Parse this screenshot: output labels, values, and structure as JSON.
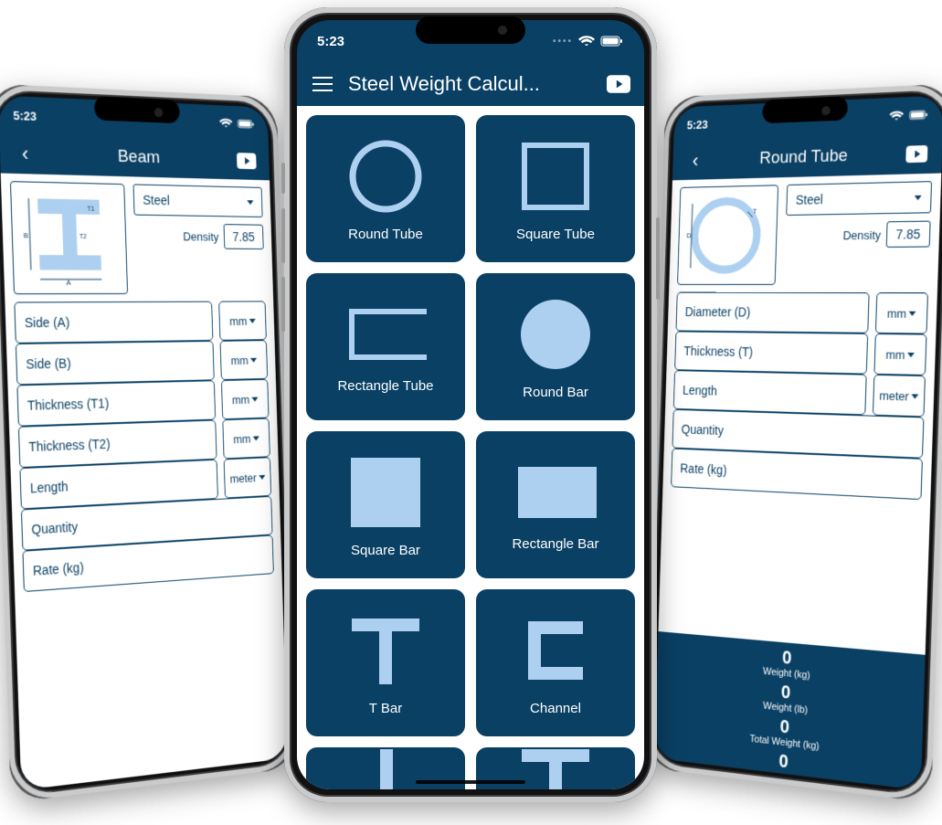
{
  "status": {
    "time": "5:23"
  },
  "center": {
    "title": "Steel Weight Calcul...",
    "tiles": [
      {
        "label": "Round Tube",
        "icon": "circle-outline"
      },
      {
        "label": "Square Tube",
        "icon": "square-outline"
      },
      {
        "label": "Rectangle Tube",
        "icon": "rect-outline"
      },
      {
        "label": "Round Bar",
        "icon": "circle-fill"
      },
      {
        "label": "Square Bar",
        "icon": "square-fill"
      },
      {
        "label": "Rectangle Bar",
        "icon": "rect-fill"
      },
      {
        "label": "T Bar",
        "icon": "t-shape"
      },
      {
        "label": "Channel",
        "icon": "c-shape"
      }
    ],
    "partial_icons": [
      "i-shape",
      "t-shape-alt"
    ]
  },
  "left": {
    "title": "Beam",
    "material": "Steel",
    "density_label": "Density",
    "density_value": "7.85",
    "fields": [
      {
        "label": "Side (A)",
        "unit": "mm"
      },
      {
        "label": "Side (B)",
        "unit": "mm"
      },
      {
        "label": "Thickness (T1)",
        "unit": "mm"
      },
      {
        "label": "Thickness (T2)",
        "unit": "mm"
      },
      {
        "label": "Length",
        "unit": "meter"
      },
      {
        "label": "Quantity",
        "unit": null
      },
      {
        "label": "Rate (kg)",
        "unit": null
      }
    ],
    "diagram_labels": {
      "a": "A",
      "b": "B",
      "t1": "T1",
      "t2": "T2"
    }
  },
  "right": {
    "title": "Round Tube",
    "material": "Steel",
    "density_label": "Density",
    "density_value": "7.85",
    "fields": [
      {
        "label": "Diameter (D)",
        "unit": "mm"
      },
      {
        "label": "Thickness (T)",
        "unit": "mm"
      },
      {
        "label": "Length",
        "unit": "meter"
      },
      {
        "label": "Quantity",
        "unit": null
      },
      {
        "label": "Rate (kg)",
        "unit": null
      }
    ],
    "diagram_labels": {
      "d": "D",
      "t": "T"
    },
    "results": [
      {
        "value": "0",
        "label": "Weight (kg)"
      },
      {
        "value": "0",
        "label": "Weight (lb)"
      },
      {
        "value": "0",
        "label": "Total Weight (kg)"
      },
      {
        "value": "0",
        "label": ""
      }
    ]
  }
}
